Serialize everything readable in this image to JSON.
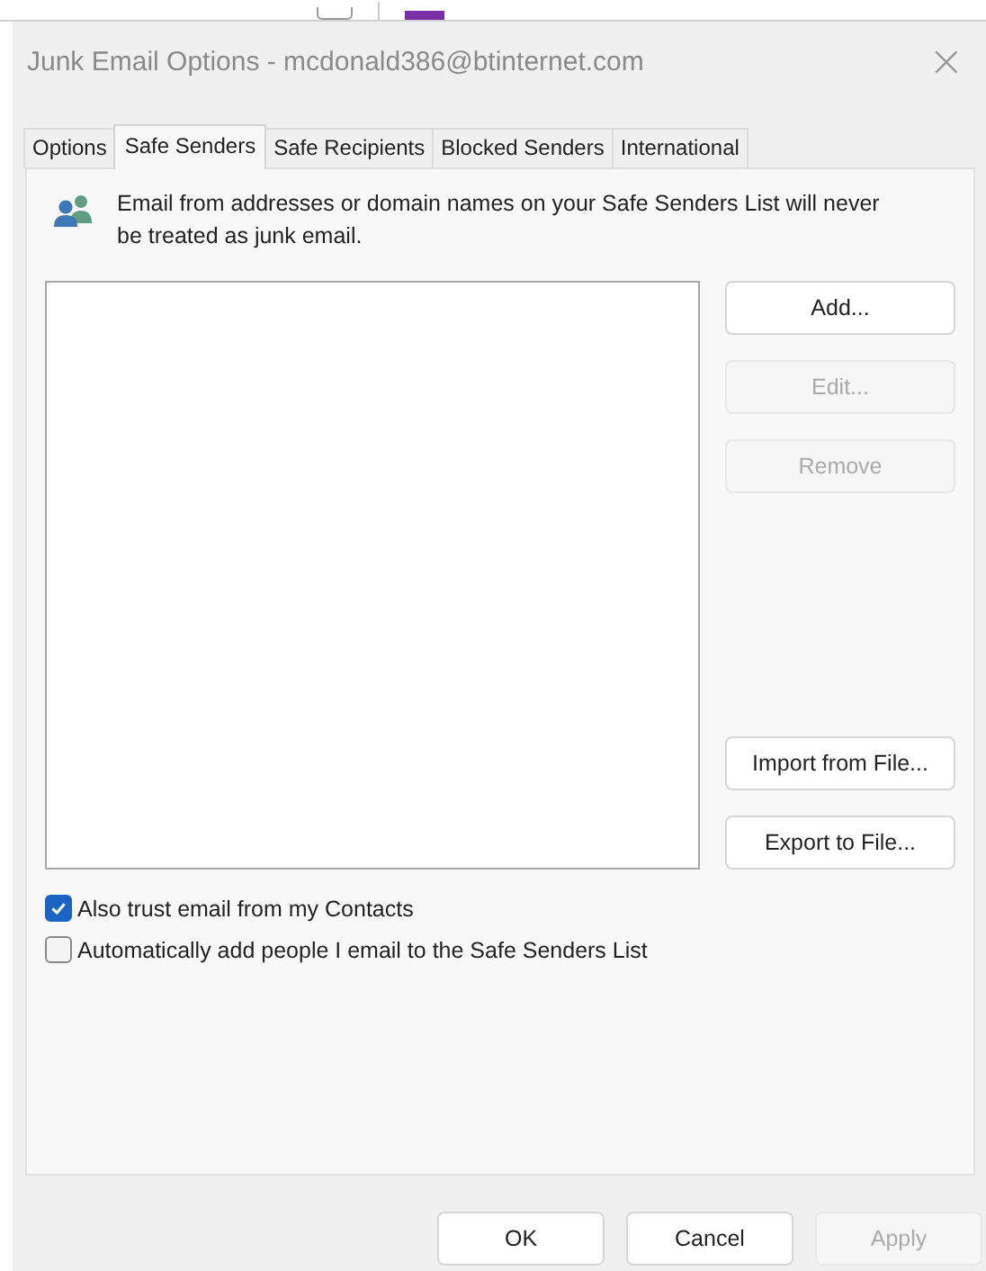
{
  "window": {
    "title": "Junk Email Options - mcdonald386@btinternet.com",
    "close": "×"
  },
  "tabs": [
    {
      "label": "Options",
      "selected": false
    },
    {
      "label": "Safe Senders",
      "selected": true
    },
    {
      "label": "Safe Recipients",
      "selected": false
    },
    {
      "label": "Blocked Senders",
      "selected": false
    },
    {
      "label": "International",
      "selected": false
    }
  ],
  "description": "Email from addresses or domain names on your Safe Senders List will never be treated as junk email.",
  "side_buttons": [
    {
      "label": "Add...",
      "disabled": false
    },
    {
      "label": "Edit...",
      "disabled": true
    },
    {
      "label": "Remove",
      "disabled": true
    },
    {
      "label": "Import from File...",
      "disabled": false
    },
    {
      "label": "Export to File...",
      "disabled": false
    }
  ],
  "checkboxes": [
    {
      "label": "Also trust email from my Contacts",
      "checked": true
    },
    {
      "label": "Automatically add people I email to the Safe Senders List",
      "checked": false
    }
  ],
  "footer_buttons": [
    {
      "label": "OK",
      "disabled": false
    },
    {
      "label": "Cancel",
      "disabled": false
    },
    {
      "label": "Apply",
      "disabled": true
    }
  ]
}
